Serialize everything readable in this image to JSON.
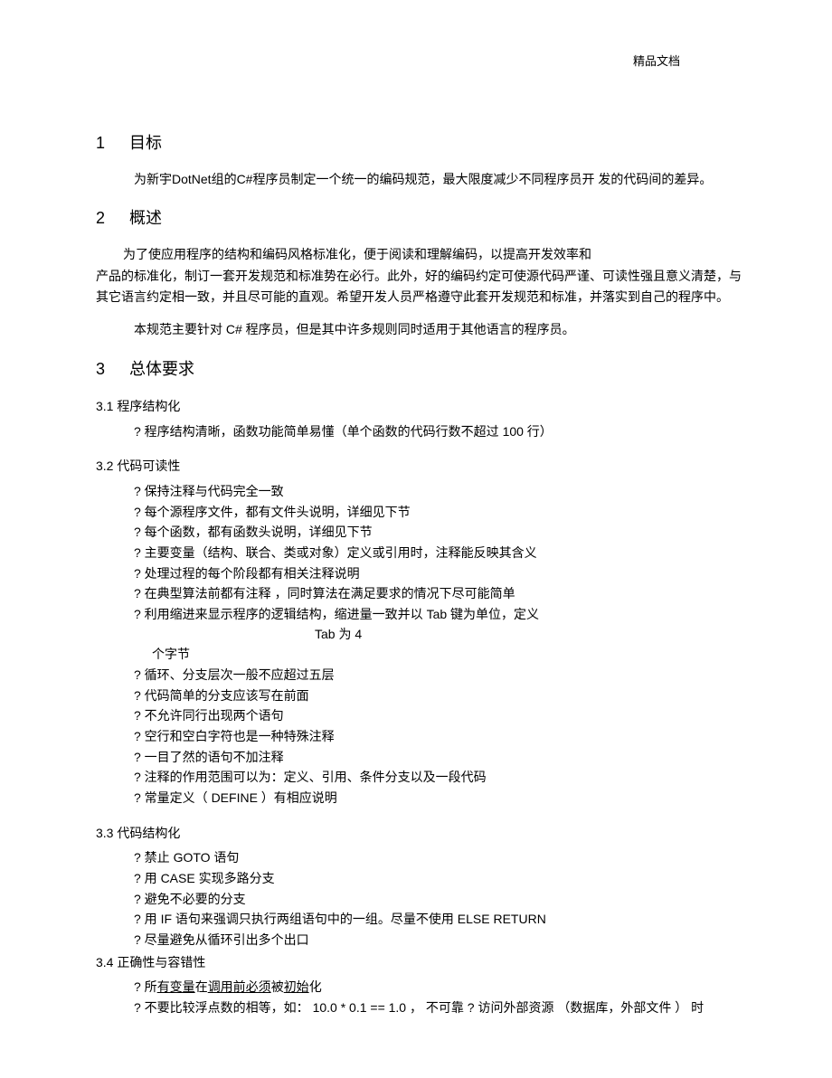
{
  "header": {
    "watermark": "精品文档"
  },
  "sections": [
    {
      "num": "1",
      "title": "目标",
      "paragraphs": [
        "为新宇DotNet组的C#程序员制定一个统一的编码规范，最大限度减少不同程序员开 发的代码间的差异。"
      ]
    },
    {
      "num": "2",
      "title": "概述",
      "paragraphs": [
        "为了使应用程序的结构和编码风格标准化，便于阅读和理解编码，以提高开发效率和",
        "产品的标准化，制订一套开发规范和标准势在必行。此外，好的编码约定可使源代码严谨、可读性强且意义清楚，与其它语言约定相一致，并且尽可能的直观。希望开发人员严格遵守此套开发规范和标准，并落实到自己的程序中。",
        "本规范主要针对     C# 程序员，但是其中许多规则同时适用于其他语言的程序员。"
      ]
    },
    {
      "num": "3",
      "title": "总体要求",
      "subsections": [
        {
          "num": "3.1",
          "title": "程序结构化",
          "items": [
            "? 程序结构清晰，函数功能简单易懂（单个函数的代码行数不超过 100 行）"
          ]
        },
        {
          "num": "3.2",
          "title": "代码可读性",
          "items": [
            "? 保持注释与代码完全一致",
            "? 每个源程序文件，都有文件头说明，详细见下节",
            "? 每个函数，都有函数头说明，详细见下节",
            "? 主要变量（结构、联合、类或对象）定义或引用时，注释能反映其含义",
            "? 处理过程的每个阶段都有相关注释说明",
            "? 在典型算法前都有注释         ，同时算法在满足要求的情况下尽可能简单",
            "? 利用缩进来显示程序的逻辑结构，缩进量一致并以 Tab 键为单位，定义",
            "个字节",
            "? 循环、分支层次一般不应超过五层",
            "? 代码简单的分支应该写在前面",
            "? 不允许同行出现两个语句",
            "? 空行和空白字符也是一种特殊注释",
            "? 一目了然的语句不加注释",
            "? 注释的作用范围可以为：定义、引用、条件分支以及一段代码",
            "? 常量定义（ DEFINE ）有相应说明"
          ],
          "tab_note": "Tab 为 4"
        },
        {
          "num": "3.3",
          "title": "代码结构化",
          "items": [
            "? 禁止 GOTO 语句",
            "? 用 CASE 实现多路分支",
            "? 避免不必要的分支",
            "? 用 IF 语句来强调只执行两组语句中的一组。尽量不使用 ELSE RETURN",
            "? 尽量避免从循环引出多个出口"
          ]
        },
        {
          "num": "3.4",
          "title": "正确性与容错性",
          "items": [
            "? 所有变量在调用前必须被初始化",
            "? 不要比较浮点数的相等，如： 10.0 * 0.1 == 1.0 ， 不可靠 ? 访问外部资源 （数据库，外部文件    ） 时"
          ]
        }
      ]
    }
  ]
}
